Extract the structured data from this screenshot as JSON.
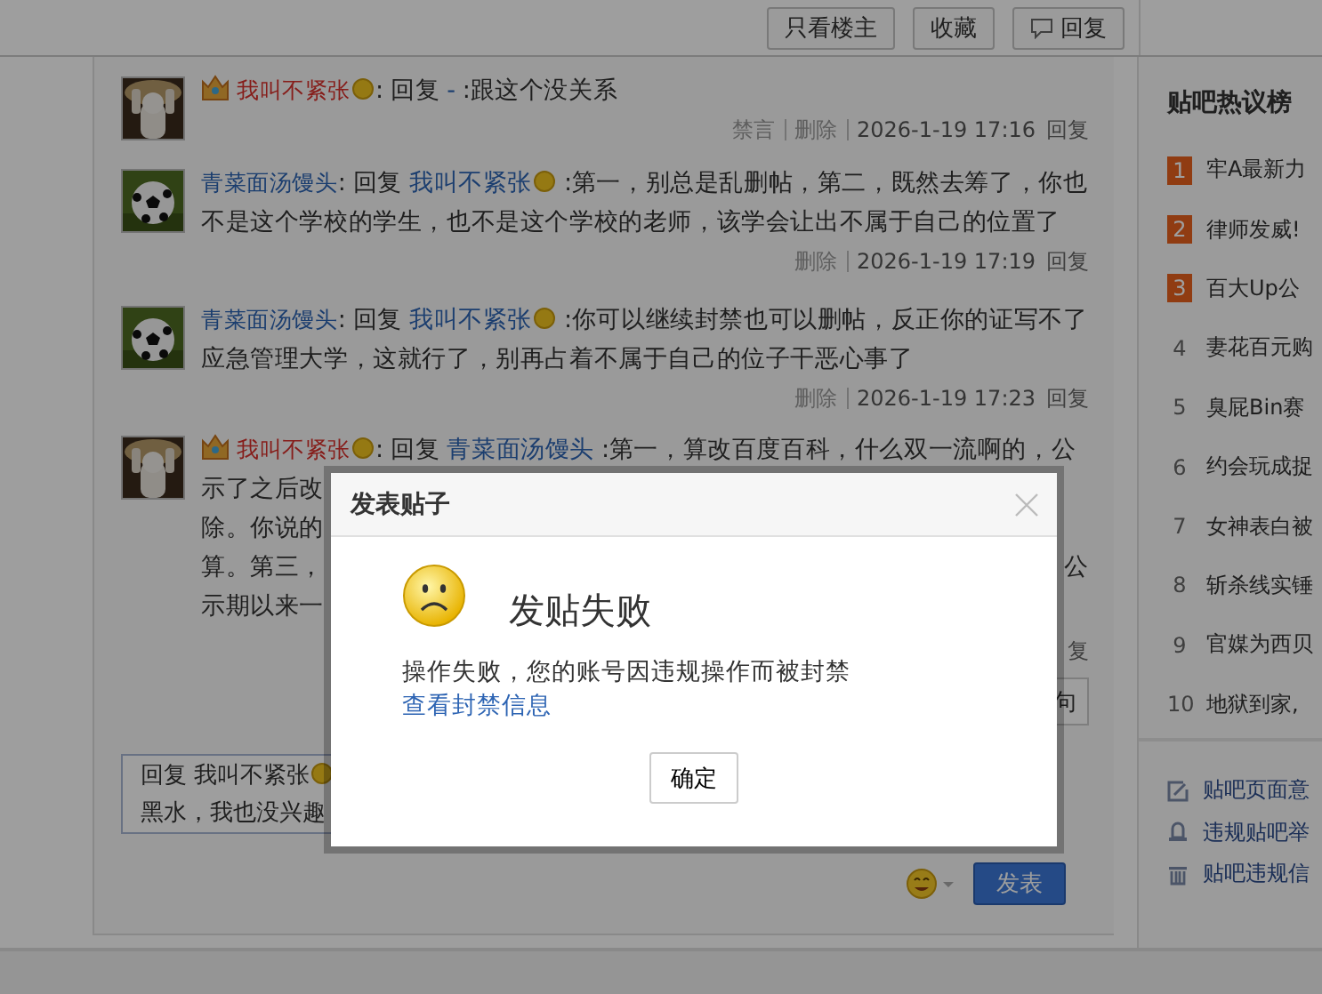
{
  "toolbar": {
    "buttons": [
      {
        "label": "只看楼主",
        "kind": "plain"
      },
      {
        "label": "收藏",
        "kind": "plain"
      },
      {
        "label": "回复",
        "kind": "comment"
      }
    ]
  },
  "replies": [
    {
      "kind": "full",
      "author": "我叫不紧张",
      "vip": true,
      "author_emoji": true,
      "reply_word": ": 回复",
      "target": "-",
      "target_emoji": false,
      "text": ":跟这个没关系",
      "actions": [
        "禁言",
        "删除"
      ],
      "time": "2026-1-19 17:16",
      "reply_link": "回复"
    },
    {
      "kind": "full",
      "author": "青菜面汤馒头",
      "vip": false,
      "author_emoji": false,
      "reply_word": ": 回复",
      "target": "我叫不紧张",
      "target_emoji": true,
      "text": ":第一，别总是乱删帖，第二，既然去筹了，你也不是这个学校的学生，也不是这个学校的老师，该学会让出不属于自己的位置了",
      "actions": [
        "删除"
      ],
      "time": "2026-1-19 17:19",
      "reply_link": "回复"
    },
    {
      "kind": "full",
      "author": "青菜面汤馒头",
      "vip": false,
      "author_emoji": false,
      "reply_word": ": 回复",
      "target": "我叫不紧张",
      "target_emoji": true,
      "text": ":你可以继续封禁也可以删帖，反正你的证写不了应急管理大学，这就行了，别再占着不属于自己的位子干恶心事了",
      "actions": [
        "删除"
      ],
      "time": "2026-1-19 17:23",
      "reply_link": "回复"
    },
    {
      "kind": "partial",
      "author": "我叫不紧张",
      "vip": true,
      "author_emoji": true,
      "reply_word": ": 回复",
      "target": "青菜面汤馒头",
      "target_emoji": false,
      "text": ":第一，算改百度百科，什么双一流啊的，公",
      "lines": [
        {
          "left": "示了之后改"
        },
        {
          "left": "除。你说的"
        },
        {
          "left": "算。第三，",
          "right": "公"
        },
        {
          "left": "示期以来一"
        }
      ],
      "reply_link": "复",
      "side_button": "句"
    }
  ],
  "reply_box": {
    "prefix": "回复 我叫不紧张",
    "emoji": true,
    "second_line": "黑水，我也没兴趣"
  },
  "submit_button": "发表",
  "sidebar": {
    "title": "贴吧热议榜",
    "items": [
      {
        "rank": "1",
        "hot": true,
        "title": "牢A最新力"
      },
      {
        "rank": "2",
        "hot": true,
        "title": "律师发威!"
      },
      {
        "rank": "3",
        "hot": true,
        "title": "百大Up公"
      },
      {
        "rank": "4",
        "hot": false,
        "title": "妻花百元购"
      },
      {
        "rank": "5",
        "hot": false,
        "title": "臭屁Bin赛"
      },
      {
        "rank": "6",
        "hot": false,
        "title": "约会玩成捉"
      },
      {
        "rank": "7",
        "hot": false,
        "title": "女神表白被"
      },
      {
        "rank": "8",
        "hot": false,
        "title": "斩杀线实锤"
      },
      {
        "rank": "9",
        "hot": false,
        "title": "官媒为西贝"
      },
      {
        "rank": "10",
        "hot": false,
        "title": "地狱到家,"
      }
    ],
    "links": [
      {
        "kind": "feedback",
        "label": "贴吧页面意"
      },
      {
        "kind": "report",
        "label": "违规贴吧举"
      },
      {
        "kind": "trash",
        "label": "贴吧违规信"
      }
    ]
  },
  "dialog": {
    "title": "发表贴子",
    "heading": "发贴失败",
    "message": "操作失败，您的账号因违规操作而被封禁",
    "link": "查看封禁信息",
    "ok_button": "确定"
  }
}
